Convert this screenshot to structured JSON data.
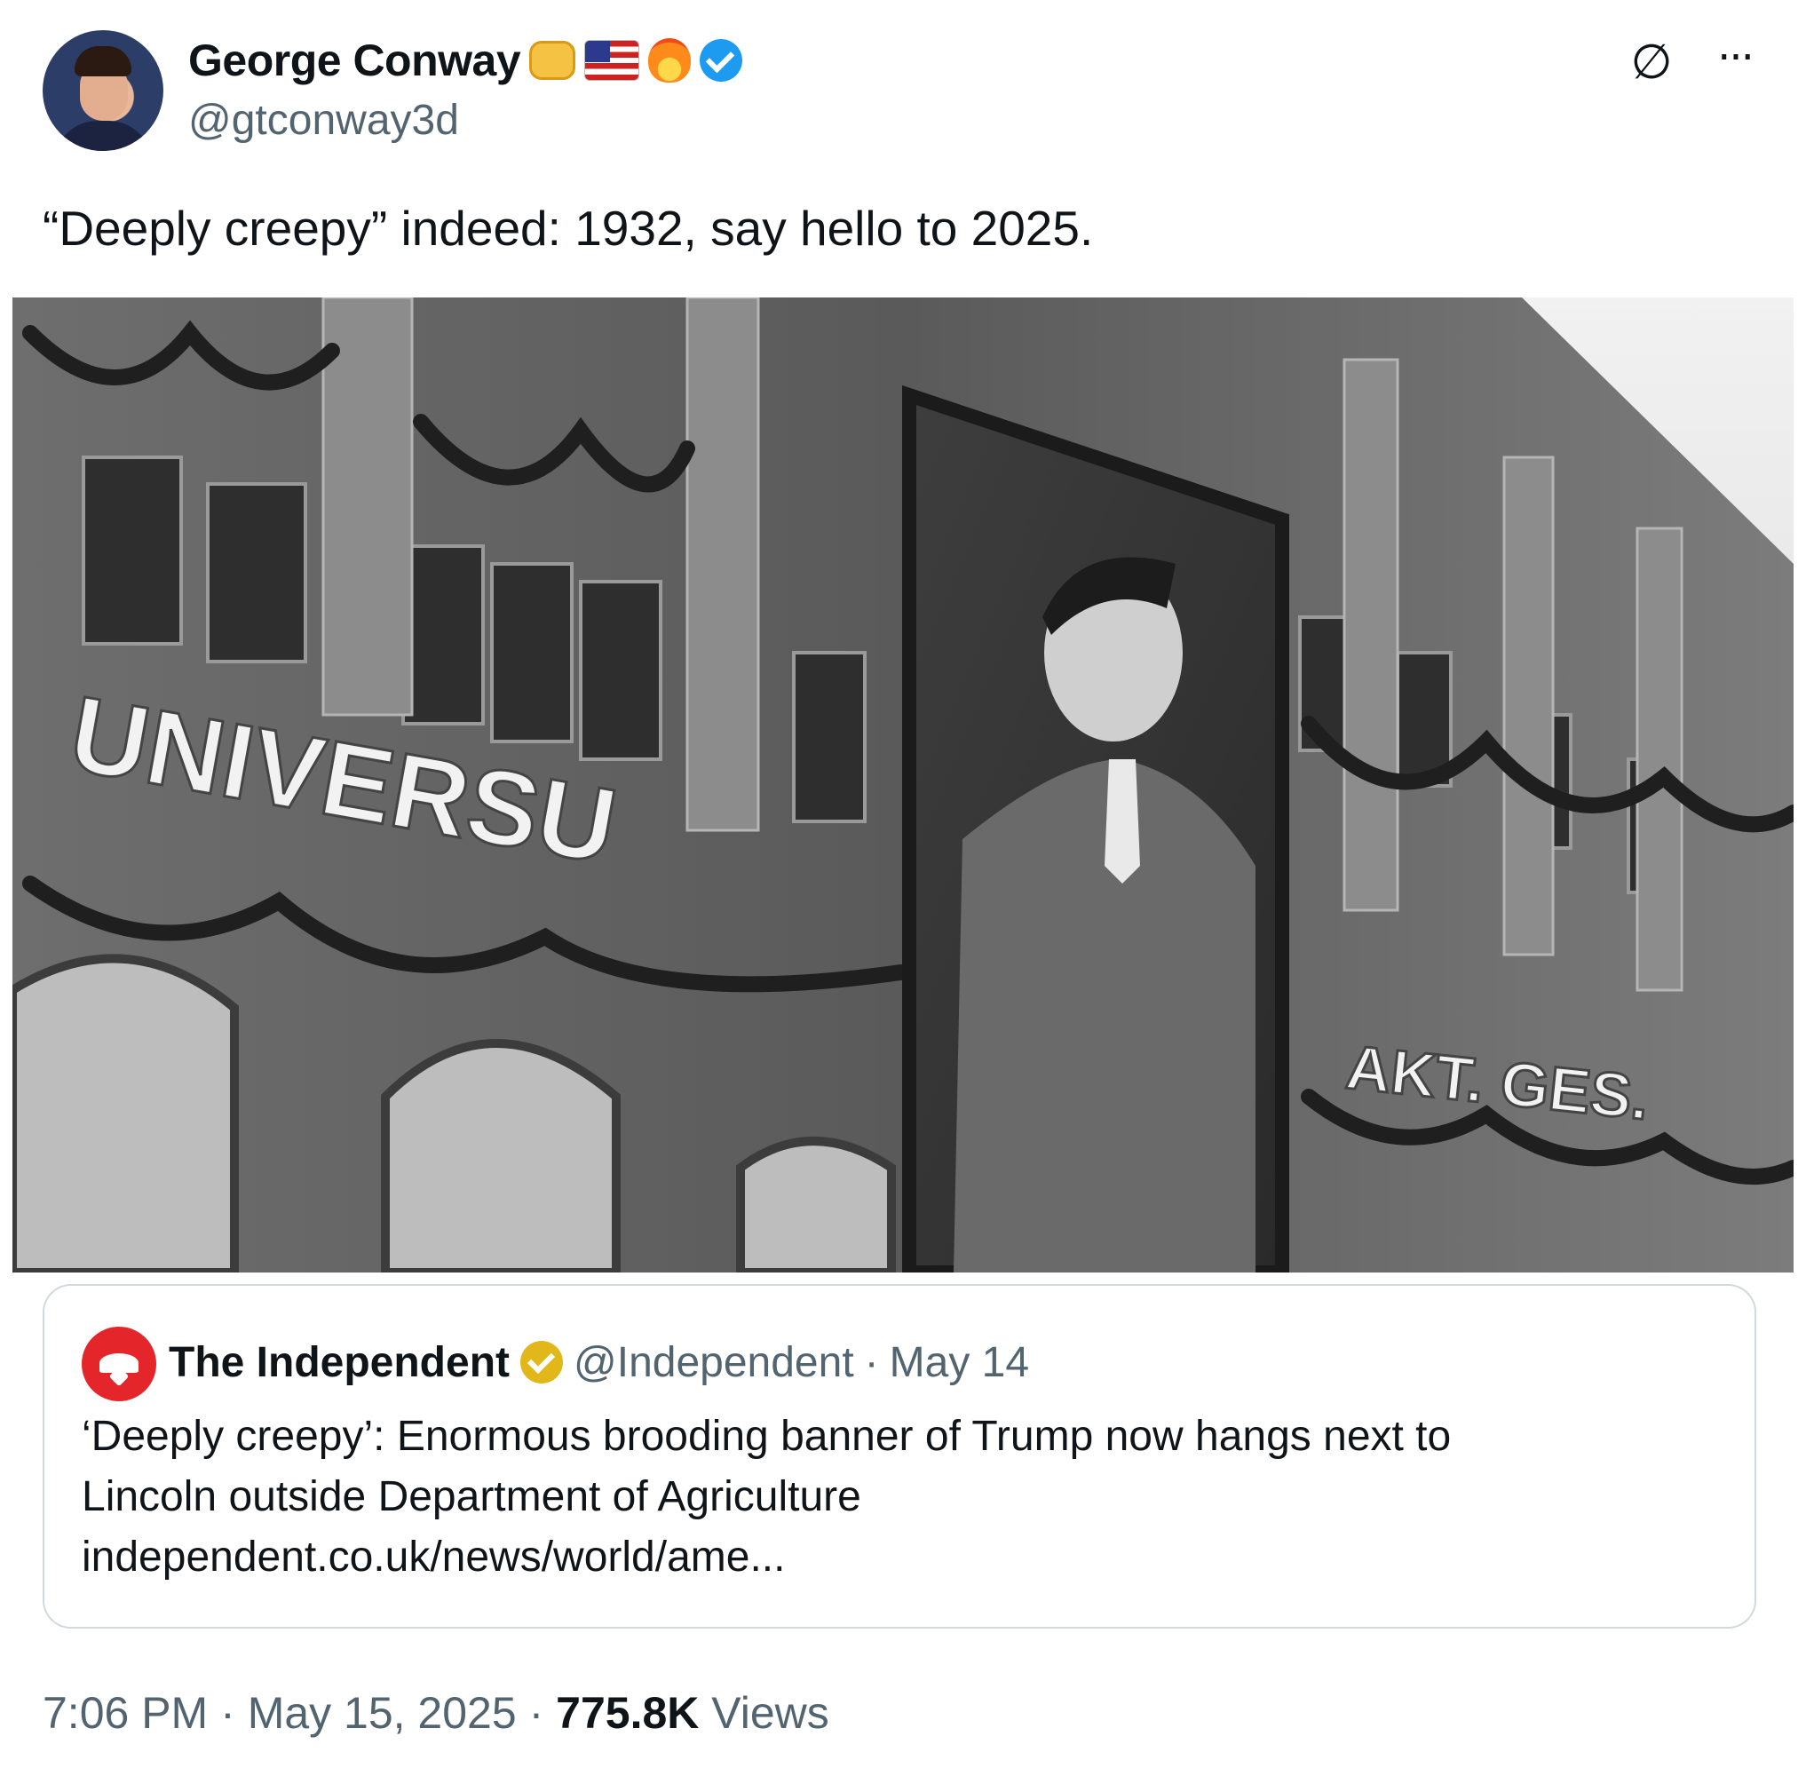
{
  "author": {
    "display_name": "George Conway",
    "handle": "@gtconway3d",
    "badges": [
      "oncoming-fist-icon",
      "us-flag-icon",
      "fire-icon",
      "verified-blue-icon"
    ]
  },
  "toolbar": {
    "grok_icon": "grok-icon",
    "more_icon": "more-icon"
  },
  "tweet": {
    "text": "“Deeply creepy” indeed:  1932, say hello to 2025."
  },
  "photo": {
    "signage_left": "UNIVERSU",
    "signage_right": "AKT. GES."
  },
  "quote": {
    "name": "The Independent",
    "handle": "@Independent",
    "separator": "·",
    "date": "May 14",
    "text_line1": "‘Deeply creepy’: Enormous brooding banner of Trump now hangs next to",
    "text_line2": "Lincoln outside Department of Agriculture",
    "link": "independent.co.uk/news/world/ame..."
  },
  "footer": {
    "time": "7:06 PM",
    "date": "May 15, 2025",
    "separator": "·",
    "views_count": "775.8K",
    "views_label": "Views"
  },
  "colors": {
    "text": "#0f1419",
    "secondary": "#536471",
    "verified_blue": "#1d9bf0",
    "verified_gold": "#e2b719",
    "independent_red": "#e4262b",
    "card_border": "#cfd9de"
  }
}
